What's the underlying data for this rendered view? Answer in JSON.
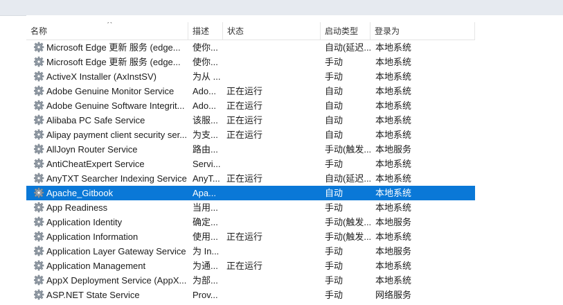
{
  "columns": {
    "name": "名称",
    "description": "描述",
    "status": "状态",
    "startup_type": "启动类型",
    "logon_as": "登录为"
  },
  "services": [
    {
      "name": "Microsoft Edge 更新 服务 (edge...",
      "description": "使你...",
      "status": "",
      "startup_type": "自动(延迟...",
      "logon_as": "本地系统",
      "selected": false
    },
    {
      "name": "Microsoft Edge 更新 服务 (edge...",
      "description": "使你...",
      "status": "",
      "startup_type": "手动",
      "logon_as": "本地系统",
      "selected": false
    },
    {
      "name": "ActiveX Installer (AxInstSV)",
      "description": "为从 ...",
      "status": "",
      "startup_type": "手动",
      "logon_as": "本地系统",
      "selected": false
    },
    {
      "name": "Adobe Genuine Monitor Service",
      "description": "Ado...",
      "status": "正在运行",
      "startup_type": "自动",
      "logon_as": "本地系统",
      "selected": false
    },
    {
      "name": "Adobe Genuine Software Integrit...",
      "description": "Ado...",
      "status": "正在运行",
      "startup_type": "自动",
      "logon_as": "本地系统",
      "selected": false
    },
    {
      "name": "Alibaba PC Safe Service",
      "description": "该服...",
      "status": "正在运行",
      "startup_type": "自动",
      "logon_as": "本地系统",
      "selected": false
    },
    {
      "name": "Alipay payment client security ser...",
      "description": "为支...",
      "status": "正在运行",
      "startup_type": "自动",
      "logon_as": "本地系统",
      "selected": false
    },
    {
      "name": "AllJoyn Router Service",
      "description": "路由...",
      "status": "",
      "startup_type": "手动(触发...",
      "logon_as": "本地服务",
      "selected": false
    },
    {
      "name": "AntiCheatExpert Service",
      "description": "Servi...",
      "status": "",
      "startup_type": "手动",
      "logon_as": "本地系统",
      "selected": false
    },
    {
      "name": "AnyTXT Searcher Indexing Service",
      "description": "AnyT...",
      "status": "正在运行",
      "startup_type": "自动(延迟...",
      "logon_as": "本地系统",
      "selected": false
    },
    {
      "name": "Apache_Gitbook",
      "description": "Apa...",
      "status": "",
      "startup_type": "自动",
      "logon_as": "本地系统",
      "selected": true
    },
    {
      "name": "App Readiness",
      "description": "当用...",
      "status": "",
      "startup_type": "手动",
      "logon_as": "本地系统",
      "selected": false
    },
    {
      "name": "Application Identity",
      "description": "确定...",
      "status": "",
      "startup_type": "手动(触发...",
      "logon_as": "本地服务",
      "selected": false
    },
    {
      "name": "Application Information",
      "description": "使用...",
      "status": "正在运行",
      "startup_type": "手动(触发...",
      "logon_as": "本地系统",
      "selected": false
    },
    {
      "name": "Application Layer Gateway Service",
      "description": "为 In...",
      "status": "",
      "startup_type": "手动",
      "logon_as": "本地服务",
      "selected": false
    },
    {
      "name": "Application Management",
      "description": "为通...",
      "status": "正在运行",
      "startup_type": "手动",
      "logon_as": "本地系统",
      "selected": false
    },
    {
      "name": "AppX Deployment Service (AppX...",
      "description": "为部...",
      "status": "",
      "startup_type": "手动",
      "logon_as": "本地系统",
      "selected": false
    },
    {
      "name": "ASP.NET State Service",
      "description": "Prov...",
      "status": "",
      "startup_type": "手动",
      "logon_as": "网络服务",
      "selected": false
    }
  ],
  "icons": {
    "row_icon": "gear-icon",
    "sort_indicator": "sort-ascending-caret"
  },
  "colors": {
    "selection": "#0a78d7",
    "header_border": "#e5e5e5"
  }
}
